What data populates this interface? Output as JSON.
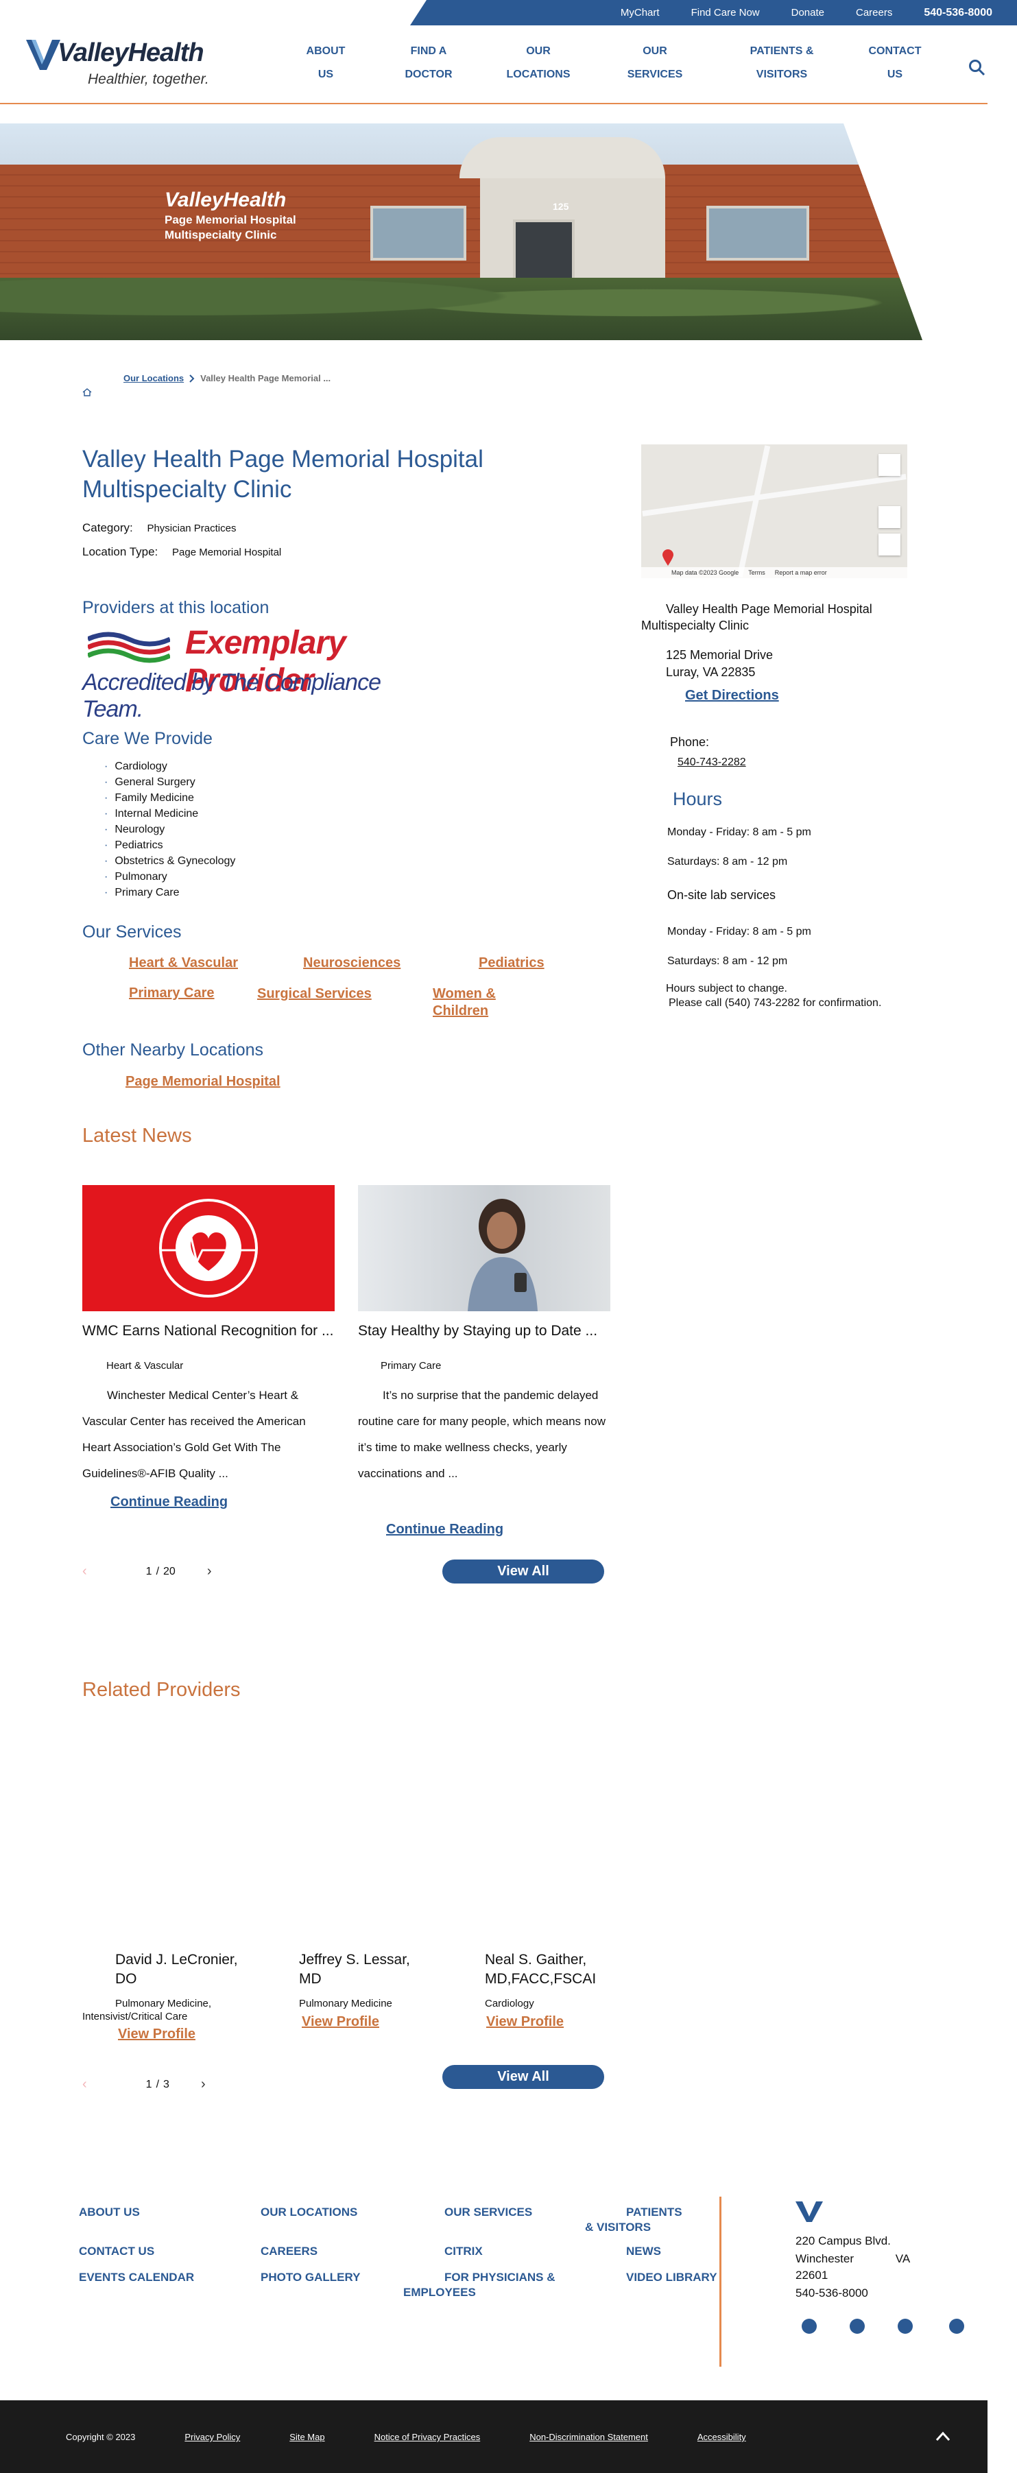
{
  "utility": {
    "mychart": "MyChart",
    "find_care": "Find Care Now",
    "donate": "Donate",
    "careers": "Careers",
    "phone": "540-536-8000"
  },
  "header": {
    "brand": "ValleyHealth",
    "tagline": "Healthier, together.",
    "nav": [
      {
        "line1": "ABOUT",
        "line2": "US"
      },
      {
        "line1": "FIND A",
        "line2": "DOCTOR"
      },
      {
        "line1": "OUR",
        "line2": "LOCATIONS"
      },
      {
        "line1": "OUR",
        "line2": "SERVICES"
      },
      {
        "line1": "PATIENTS &",
        "line2": "VISITORS"
      },
      {
        "line1": "CONTACT",
        "line2": "US"
      }
    ]
  },
  "hero": {
    "sign_brand": "ValleyHealth",
    "sign_line1": "Page Memorial Hospital",
    "sign_line2": "Multispecialty Clinic",
    "number": "125"
  },
  "breadcrumb": {
    "locations": "Our Locations",
    "current": "Valley Health Page Memorial ..."
  },
  "page": {
    "title": "Valley Health Page Memorial Hospital Multispecialty Clinic",
    "category_label": "Category:",
    "category_value": "Physician Practices",
    "location_type_label": "Location Type:",
    "location_type_value": "Page Memorial Hospital"
  },
  "providers_section": {
    "heading": "Providers at this location",
    "logo_line1": "Exemplary Provider",
    "logo_line2": "Accredited by The Compliance Team."
  },
  "care": {
    "heading": "Care We Provide",
    "items": [
      "Cardiology",
      "General Surgery",
      "Family Medicine",
      "Internal Medicine",
      "Neurology",
      "Pediatrics",
      "Obstetrics & Gynecology",
      "Pulmonary",
      "Primary Care"
    ]
  },
  "services": {
    "heading": "Our Services",
    "links": [
      "Heart & Vascular",
      "Neurosciences",
      "Pediatrics",
      "Primary Care",
      "Surgical Services",
      "Women & Children"
    ]
  },
  "nearby": {
    "heading": "Other Nearby Locations",
    "link": "Page Memorial Hospital"
  },
  "news": {
    "heading": "Latest News",
    "cards": [
      {
        "title": "WMC Earns National Recognition for ...",
        "category": "Heart & Vascular",
        "body": "Winchester Medical Center’s Heart & Vascular Center has received the American Heart Association’s Gold Get With The Guidelines®-AFIB Quality ...",
        "more": "Continue Reading"
      },
      {
        "title": "Stay Healthy by Staying up to Date ...",
        "category": "Primary Care",
        "body": "It’s no surprise that the pandemic delayed routine care for many people, which means now it’s time to make wellness checks, yearly vaccinations and ...",
        "more": "Continue Reading"
      }
    ],
    "pager": {
      "current": "1",
      "sep": "/",
      "total": "20"
    },
    "view_all": "View All"
  },
  "related": {
    "heading": "Related Providers",
    "providers": [
      {
        "name_line1": "David J. LeCronier,",
        "name_line2": "DO",
        "specialty": "Pulmonary Medicine, Intensivist/Critical Care",
        "link": "View Profile"
      },
      {
        "name_line1": "Jeffrey S. Lessar,",
        "name_line2": "MD",
        "specialty": "Pulmonary Medicine",
        "link": "View Profile"
      },
      {
        "name_line1": "Neal S. Gaither,",
        "name_line2": "MD,FACC,FSCAI",
        "specialty": "Cardiology",
        "link": "View Profile"
      }
    ],
    "pager": {
      "current": "1",
      "sep": "/",
      "total": "3"
    },
    "view_all": "View All"
  },
  "map": {
    "data": "Map data ©2023 Google",
    "terms": "Terms",
    "report": "Report a map error"
  },
  "contact": {
    "name": "Valley Health Page Memorial Hospital Multispecialty Clinic",
    "street": "125 Memorial Drive",
    "city": "Luray, VA 22835",
    "directions": "Get Directions",
    "phone_label": "Phone:",
    "phone": "540-743-2282"
  },
  "hours": {
    "heading": "Hours",
    "line1": "Monday - Friday: 8 am - 5 pm",
    "line2": "Saturdays: 8 am - 12 pm",
    "lab": "On-site lab services",
    "line3": "Monday - Friday: 8 am - 5 pm",
    "line4": "Saturdays: 8 am - 12 pm",
    "note1": "Hours subject to change.",
    "note2": "Please call (540) 743-2282 for confirmation."
  },
  "footer": {
    "links": [
      "ABOUT US",
      "OUR LOCATIONS",
      "OUR SERVICES",
      "PATIENTS & VISITORS",
      "CONTACT US",
      "CAREERS",
      "CITRIX",
      "NEWS",
      "EVENTS CALENDAR",
      "PHOTO GALLERY",
      "FOR PHYSICIANS & EMPLOYEES",
      "VIDEO LIBRARY"
    ],
    "address_street": "220 Campus Blvd.",
    "address_city": "Winchester",
    "address_state": "VA",
    "address_zip": "22601",
    "address_phone": "540-536-8000",
    "copyright": "Copyright © 2023",
    "bottom_links": [
      "Privacy Policy",
      "Site Map",
      "Notice of Privacy Practices",
      "Non-Discrimination Statement",
      "Accessibility"
    ]
  },
  "colors": {
    "primary": "#2b5993",
    "accent": "#c9733e",
    "footer_bg": "#1b1b1b",
    "news_red": "#e2161d"
  }
}
